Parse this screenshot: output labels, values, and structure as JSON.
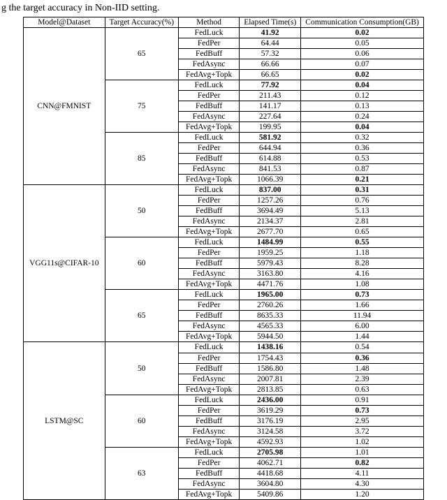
{
  "caption": "g the target accuracy in Non-IID setting.",
  "headers": {
    "model": "Model@Dataset",
    "target": "Target Accuracy(%)",
    "method": "Method",
    "elapsed": "Elapsed Time(s)",
    "comm": "Communication Consumption(GB)"
  },
  "chart_data": {
    "type": "table",
    "columns": [
      "Model@Dataset",
      "Target Accuracy(%)",
      "Method",
      "Elapsed Time(s)",
      "Communication Consumption(GB)"
    ],
    "groups": [
      {
        "model": "CNN@FMNIST",
        "blocks": [
          {
            "target": "65",
            "rows": [
              {
                "method": "FedLuck",
                "elapsed": "41.92",
                "comm": "0.02",
                "b_e": true,
                "b_c": true
              },
              {
                "method": "FedPer",
                "elapsed": "64.44",
                "comm": "0.05"
              },
              {
                "method": "FedBuff",
                "elapsed": "57.32",
                "comm": "0.06"
              },
              {
                "method": "FedAsync",
                "elapsed": "66.66",
                "comm": "0.07"
              },
              {
                "method": "FedAvg+Topk",
                "elapsed": "66.65",
                "comm": "0.02",
                "b_c": true
              }
            ]
          },
          {
            "target": "75",
            "rows": [
              {
                "method": "FedLuck",
                "elapsed": "77.92",
                "comm": "0.04",
                "b_e": true,
                "b_c": true
              },
              {
                "method": "FedPer",
                "elapsed": "211.43",
                "comm": "0.12"
              },
              {
                "method": "FedBuff",
                "elapsed": "141.17",
                "comm": "0.13"
              },
              {
                "method": "FedAsync",
                "elapsed": "227.64",
                "comm": "0.24"
              },
              {
                "method": "FedAvg+Topk",
                "elapsed": "199.95",
                "comm": "0.04",
                "b_c": true
              }
            ]
          },
          {
            "target": "85",
            "rows": [
              {
                "method": "FedLuck",
                "elapsed": "581.92",
                "comm": "0.32",
                "b_e": true
              },
              {
                "method": "FedPer",
                "elapsed": "644.94",
                "comm": "0.36"
              },
              {
                "method": "FedBuff",
                "elapsed": "614.88",
                "comm": "0.53"
              },
              {
                "method": "FedAsync",
                "elapsed": "841.53",
                "comm": "0.87"
              },
              {
                "method": "FedAvg+Topk",
                "elapsed": "1066.39",
                "comm": "0.21",
                "b_c": true
              }
            ]
          }
        ]
      },
      {
        "model": "VGG11s@CIFAR-10",
        "blocks": [
          {
            "target": "50",
            "rows": [
              {
                "method": "FedLuck",
                "elapsed": "837.00",
                "comm": "0.31",
                "b_e": true,
                "b_c": true
              },
              {
                "method": "FedPer",
                "elapsed": "1257.26",
                "comm": "0.76"
              },
              {
                "method": "FedBuff",
                "elapsed": "3694.49",
                "comm": "5.13"
              },
              {
                "method": "FedAsync",
                "elapsed": "2134.37",
                "comm": "2.81"
              },
              {
                "method": "FedAvg+Topk",
                "elapsed": "2677.70",
                "comm": "0.65"
              }
            ]
          },
          {
            "target": "60",
            "rows": [
              {
                "method": "FedLuck",
                "elapsed": "1484.99",
                "comm": "0.55",
                "b_e": true,
                "b_c": true
              },
              {
                "method": "FedPer",
                "elapsed": "1959.25",
                "comm": "1.18"
              },
              {
                "method": "FedBuff",
                "elapsed": "5979.43",
                "comm": "8.28"
              },
              {
                "method": "FedAsync",
                "elapsed": "3163.80",
                "comm": "4.16"
              },
              {
                "method": "FedAvg+Topk",
                "elapsed": "4471.76",
                "comm": "1.08"
              }
            ]
          },
          {
            "target": "65",
            "rows": [
              {
                "method": "FedLuck",
                "elapsed": "1965.00",
                "comm": "0.73",
                "b_e": true,
                "b_c": true
              },
              {
                "method": "FedPer",
                "elapsed": "2760.26",
                "comm": "1.66"
              },
              {
                "method": "FedBuff",
                "elapsed": "8635.33",
                "comm": "11.94"
              },
              {
                "method": "FedAsync",
                "elapsed": "4565.33",
                "comm": "6.00"
              },
              {
                "method": "FedAvg+Topk",
                "elapsed": "5944.50",
                "comm": "1.44"
              }
            ]
          }
        ]
      },
      {
        "model": "LSTM@SC",
        "blocks": [
          {
            "target": "50",
            "rows": [
              {
                "method": "FedLuck",
                "elapsed": "1438.16",
                "comm": "0.54",
                "b_e": true
              },
              {
                "method": "FedPer",
                "elapsed": "1754.43",
                "comm": "0.36",
                "b_c": true
              },
              {
                "method": "FedBuff",
                "elapsed": "1586.80",
                "comm": "1.48"
              },
              {
                "method": "FedAsync",
                "elapsed": "2007.81",
                "comm": "2.39"
              },
              {
                "method": "FedAvg+Topk",
                "elapsed": "2813.85",
                "comm": "0.63"
              }
            ]
          },
          {
            "target": "60",
            "rows": [
              {
                "method": "FedLuck",
                "elapsed": "2436.00",
                "comm": "0.91",
                "b_e": true
              },
              {
                "method": "FedPer",
                "elapsed": "3619.29",
                "comm": "0.73",
                "b_c": true
              },
              {
                "method": "FedBuff",
                "elapsed": "3176.19",
                "comm": "2.95"
              },
              {
                "method": "FedAsync",
                "elapsed": "3124.58",
                "comm": "3.72"
              },
              {
                "method": "FedAvg+Topk",
                "elapsed": "4592.93",
                "comm": "1.02"
              }
            ]
          },
          {
            "target": "63",
            "rows": [
              {
                "method": "FedLuck",
                "elapsed": "2705.98",
                "comm": "1.01",
                "b_e": true
              },
              {
                "method": "FedPer",
                "elapsed": "4062.71",
                "comm": "0.82",
                "b_c": true
              },
              {
                "method": "FedBuff",
                "elapsed": "4418.68",
                "comm": "4.11"
              },
              {
                "method": "FedAsync",
                "elapsed": "3604.80",
                "comm": "4.30"
              },
              {
                "method": "FedAvg+Topk",
                "elapsed": "5409.86",
                "comm": "1.20"
              }
            ]
          }
        ]
      }
    ]
  }
}
